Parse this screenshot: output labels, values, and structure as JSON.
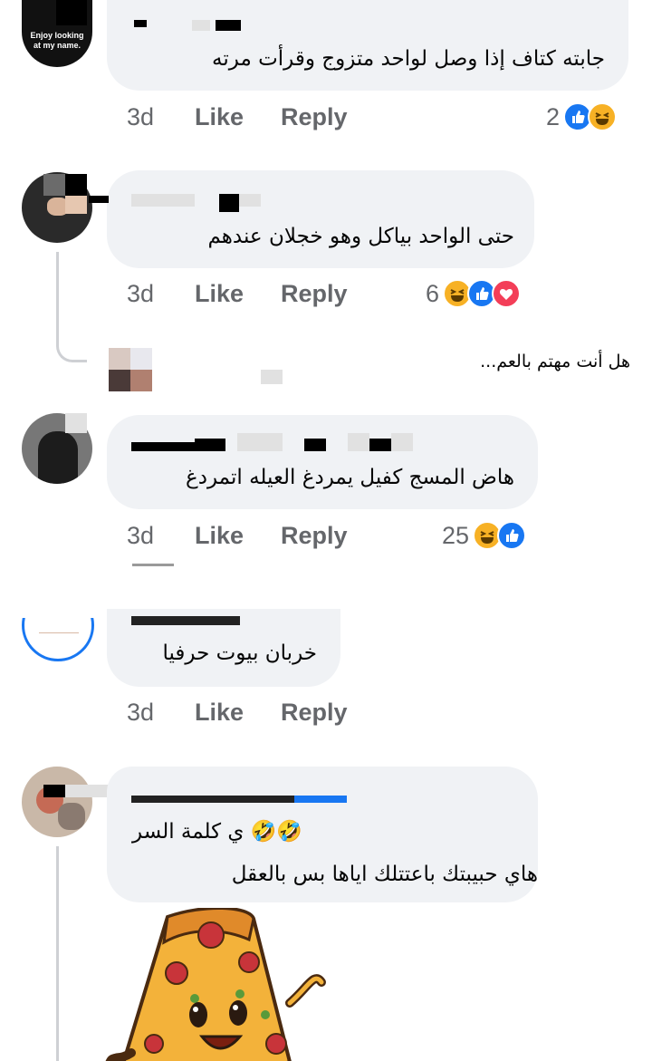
{
  "comments": [
    {
      "avatar_text": "Enjoy looking at my name.",
      "text": "جابته كتاف إذا وصل لواحد متزوج وقرأت مرته",
      "time": "3d",
      "like": "Like",
      "reply": "Reply",
      "reactions_count": "2"
    },
    {
      "text": "حتى الواحد بياكل وهو خجلان عندهم",
      "time": "3d",
      "like": "Like",
      "reply": "Reply",
      "reactions_count": "6"
    },
    {
      "text": "هاض المسج كفيل يمردغ العيله اتمردغ",
      "time": "3d",
      "like": "Like",
      "reply": "Reply",
      "reactions_count": "25"
    },
    {
      "text": "خربان بيوت حرفيا",
      "time": "3d",
      "like": "Like",
      "reply": "Reply"
    },
    {
      "text_line1": "ي كلمة السر 🤣🤣",
      "text_line2": "هاي حبيبتك باعتتلك اياها بس بالعقل"
    }
  ],
  "reply_preview": {
    "text": "هل أنت مهتم بالعم..."
  },
  "colors": {
    "bubble": "#f0f2f5",
    "meta": "#65676b",
    "like_blue": "#1877f2",
    "haha_yellow": "#f7b125",
    "love_red": "#f33e58"
  },
  "icons": [
    "like-reaction-icon",
    "haha-reaction-icon",
    "love-reaction-icon",
    "pizza-sticker"
  ]
}
